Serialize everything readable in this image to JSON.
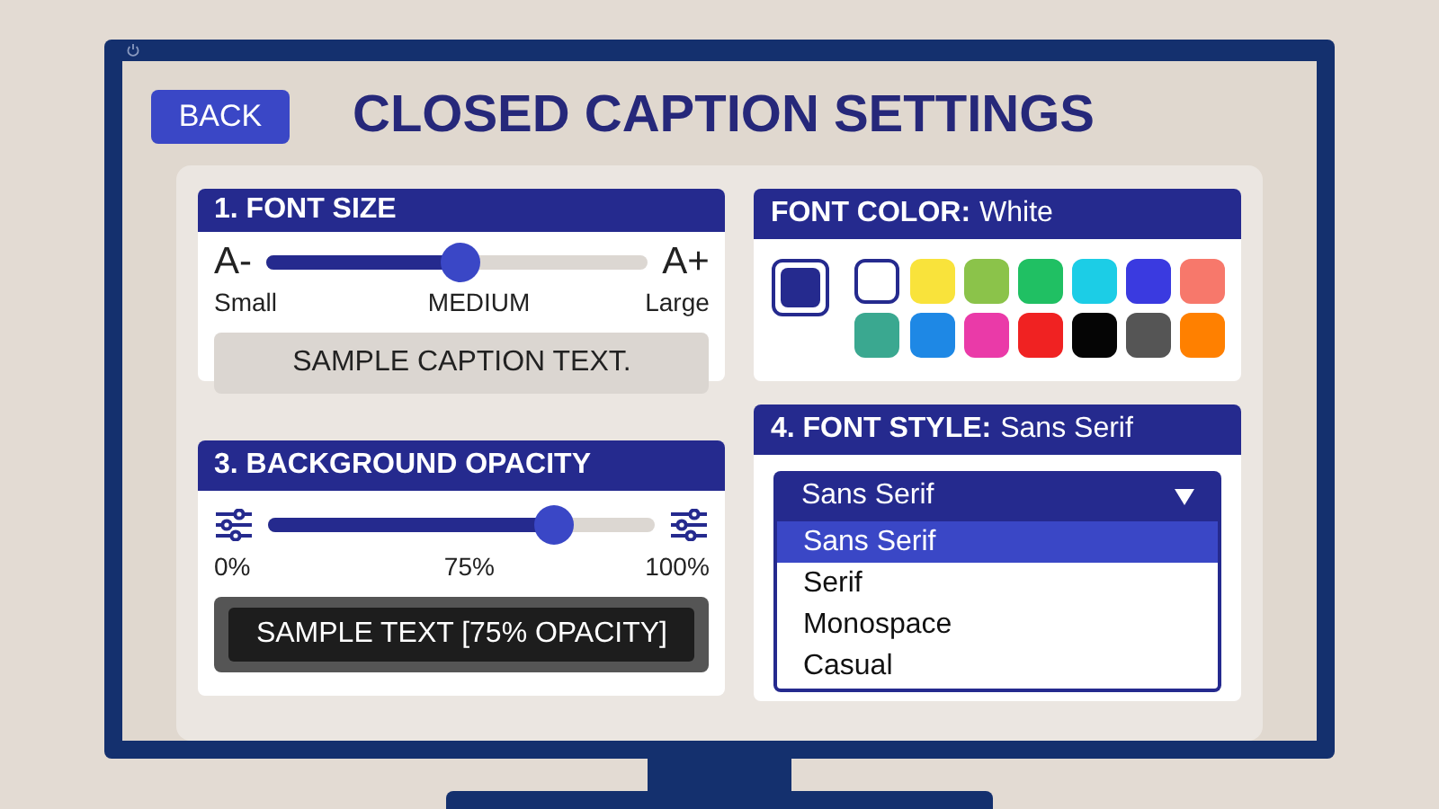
{
  "header": {
    "back_button": "BACK",
    "title": "CLOSED CAPTION SETTINGS"
  },
  "font_size": {
    "title": "1. FONT SIZE",
    "min_label": "A-",
    "max_label": "A+",
    "level": 0.51,
    "left_caption": "Small",
    "center_caption": "MEDIUM",
    "right_caption": "Large",
    "sample": "SAMPLE CAPTION TEXT."
  },
  "background_opacity": {
    "title": "3. BACKGROUND OPACITY",
    "level": 0.74,
    "left_caption": "0%",
    "center_caption": "75%",
    "right_caption": "100%",
    "sample": "SAMPLE TEXT [75% OPACITY]"
  },
  "font_color": {
    "title": "FONT COLOR:",
    "value": "White",
    "swatches": [
      {
        "color": "#ffffff",
        "selected": true
      },
      {
        "color": "#f9e33b",
        "selected": false
      },
      {
        "color": "#8bc34a",
        "selected": false
      },
      {
        "color": "#20c063",
        "selected": false
      },
      {
        "color": "#1ccde6",
        "selected": false
      },
      {
        "color": "#3a3ae0",
        "selected": false
      },
      {
        "color": "#f7786b",
        "selected": false
      },
      {
        "color": "#3aa890",
        "selected": false
      },
      {
        "color": "#1e88e5",
        "selected": false
      },
      {
        "color": "#ea3aa8",
        "selected": false
      },
      {
        "color": "#f02222",
        "selected": false
      },
      {
        "color": "#050505",
        "selected": false
      },
      {
        "color": "#555555",
        "selected": false
      },
      {
        "color": "#ff8000",
        "selected": false
      }
    ]
  },
  "font_style": {
    "title": "4. FONT STYLE:",
    "value": "Sans Serif",
    "dropdown_value": "Sans Serif",
    "expanded": true,
    "options": [
      {
        "label": "Sans Serif",
        "selected": true
      },
      {
        "label": "Serif",
        "selected": false
      },
      {
        "label": "Monospace",
        "selected": false
      },
      {
        "label": "Casual",
        "selected": false
      }
    ]
  }
}
